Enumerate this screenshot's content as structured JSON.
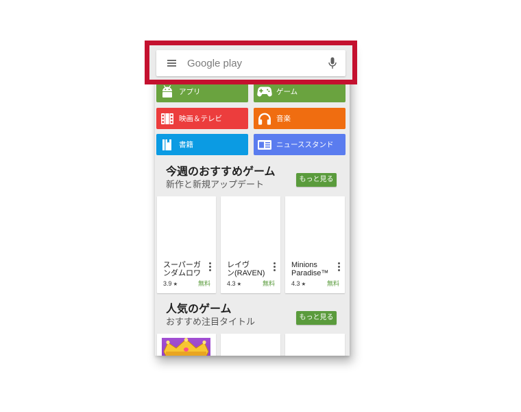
{
  "search": {
    "placeholder": "Google play"
  },
  "categories": [
    {
      "label": "アプリ",
      "icon": "android-icon",
      "color": "#6aa33f"
    },
    {
      "label": "ゲーム",
      "icon": "gamepad-icon",
      "color": "#6aa33f"
    },
    {
      "label": "映画＆テレビ",
      "icon": "film-icon",
      "color": "#ec3d3d"
    },
    {
      "label": "音楽",
      "icon": "headphones-icon",
      "color": "#f06d10"
    },
    {
      "label": "書籍",
      "icon": "book-icon",
      "color": "#0b9be3"
    },
    {
      "label": "ニューススタンド",
      "icon": "newspaper-icon",
      "color": "#5a7cef"
    }
  ],
  "sections": [
    {
      "title": "今週のおすすめゲーム",
      "subtitle": "新作と新規アップデート",
      "more_label": "もっと見る",
      "items": [
        {
          "title_lines": [
            "スーパーガ",
            "ンダムロワ"
          ],
          "rating": "3.9",
          "price": "無料"
        },
        {
          "title_lines": [
            "レイヴ",
            "ン(RAVEN)"
          ],
          "rating": "4.3",
          "price": "無料"
        },
        {
          "title_lines": [
            "Minions",
            "Paradise™"
          ],
          "rating": "4.3",
          "price": "無料"
        }
      ]
    },
    {
      "title": "人気のゲーム",
      "subtitle": "おすすめ注目タイトル",
      "more_label": "もっと見る",
      "items": [
        {
          "icon": "crown-icon"
        }
      ]
    }
  ],
  "colors": {
    "accent_green": "#5a9b3c",
    "highlight_red": "#c4112f"
  }
}
